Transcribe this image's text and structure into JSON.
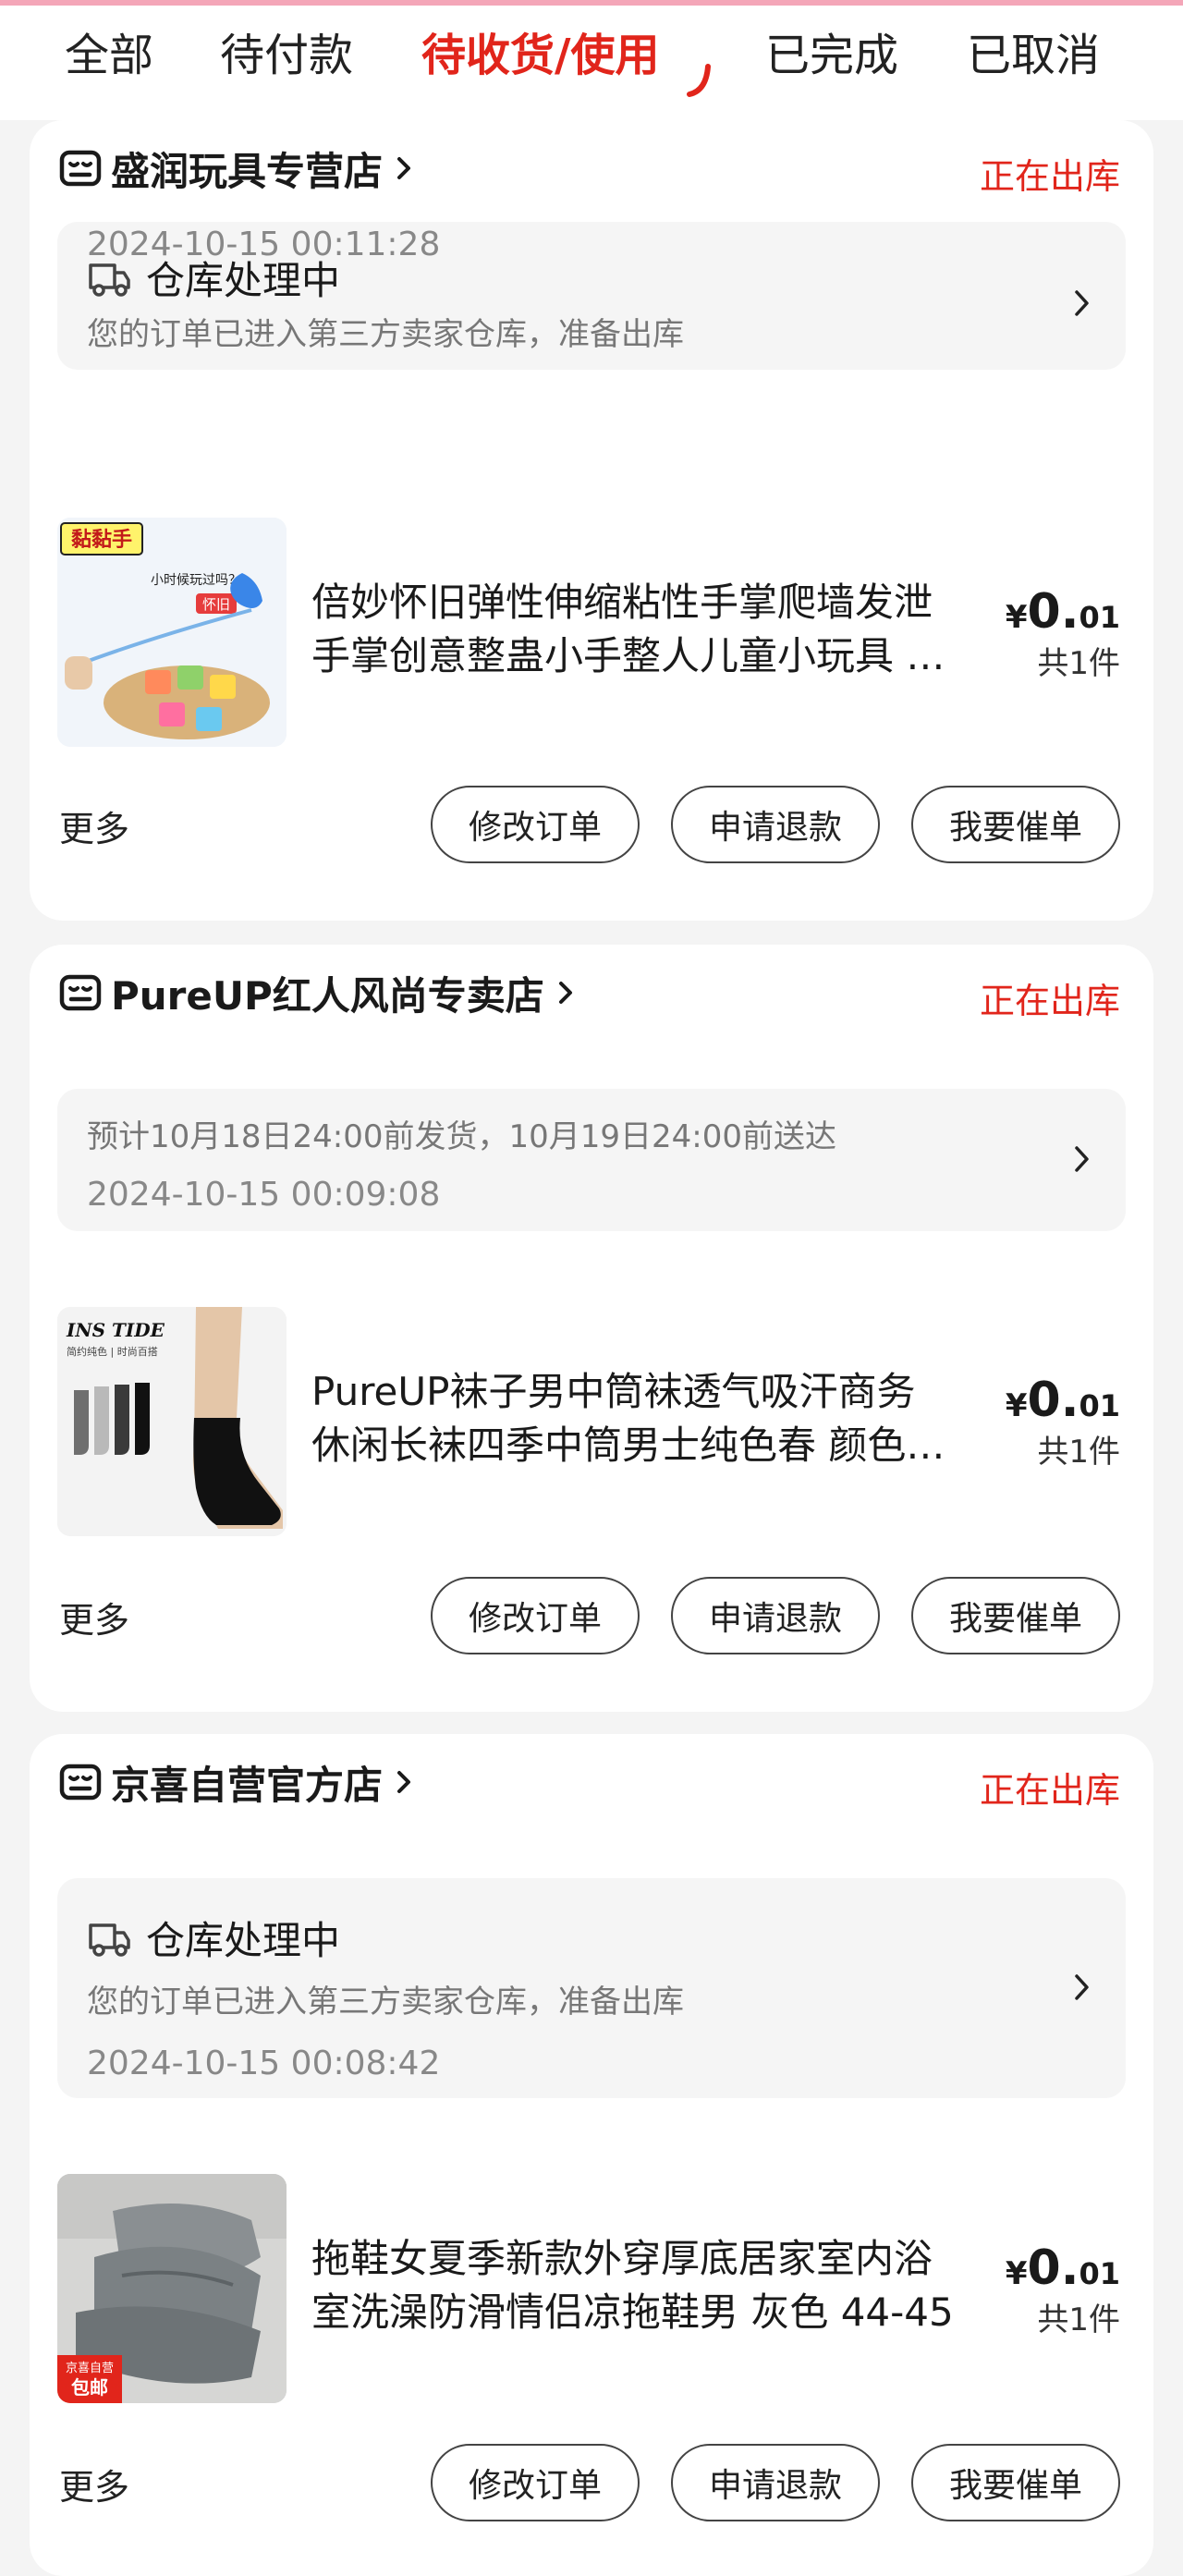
{
  "tabs": [
    {
      "label": "全部"
    },
    {
      "label": "待付款"
    },
    {
      "label": "待收货/使用"
    },
    {
      "label": "已完成"
    },
    {
      "label": "已取消"
    }
  ],
  "active_tab": "待收货/使用",
  "colors": {
    "accent": "#e1251b",
    "background": "#f4f4f4",
    "card": "#ffffff",
    "info_box": "#f5f5f5"
  },
  "orders": [
    {
      "shop_name": "盛润玩具专营店",
      "status": "正在出库",
      "info_title": "仓库处理中",
      "info_desc": "您的订单已进入第三方卖家仓库，准备出库",
      "info_time": "2024-10-15 00:11:28",
      "product_line1": "倍妙怀旧弹性伸缩粘性手掌爬墙发泄",
      "product_line2": "手掌创意整蛊小手整人儿童小玩具 …",
      "price_symbol": "¥",
      "price_int": "0.",
      "price_dec": "01",
      "quantity": "共1件",
      "thumb_label": "黏黏手",
      "thumb_bubble": "小时候玩过吗？",
      "thumb_tag": "怀旧",
      "more": "更多",
      "buttons": [
        "修改订单",
        "申请退款",
        "我要催单"
      ]
    },
    {
      "shop_name": "PureUP红人风尚专卖店",
      "status": "正在出库",
      "info_desc": "预计10月18日24:00前发货，10月19日24:00前送达",
      "info_time": "2024-10-15 00:09:08",
      "product_line1": "PureUP袜子男中筒袜透气吸汗商务",
      "product_line2": "休闲长袜四季中筒男士纯色春 颜色…",
      "price_symbol": "¥",
      "price_int": "0.",
      "price_dec": "01",
      "quantity": "共1件",
      "thumb_label": "INS TIDE",
      "thumb_sub": "简约纯色 | 时尚百搭",
      "more": "更多",
      "buttons": [
        "修改订单",
        "申请退款",
        "我要催单"
      ]
    },
    {
      "shop_name": "京喜自营官方店",
      "status": "正在出库",
      "info_title": "仓库处理中",
      "info_desc": "您的订单已进入第三方卖家仓库，准备出库",
      "info_time": "2024-10-15 00:08:42",
      "product_line1": "拖鞋女夏季新款外穿厚底居家室内浴",
      "product_line2": "室洗澡防滑情侣凉拖鞋男 灰色 44-45",
      "price_symbol": "¥",
      "price_int": "0.",
      "price_dec": "01",
      "quantity": "共1件",
      "thumb_badge_top": "京喜自营",
      "thumb_badge_bottom": "包邮",
      "more": "更多",
      "buttons": [
        "修改订单",
        "申请退款",
        "我要催单"
      ]
    }
  ]
}
